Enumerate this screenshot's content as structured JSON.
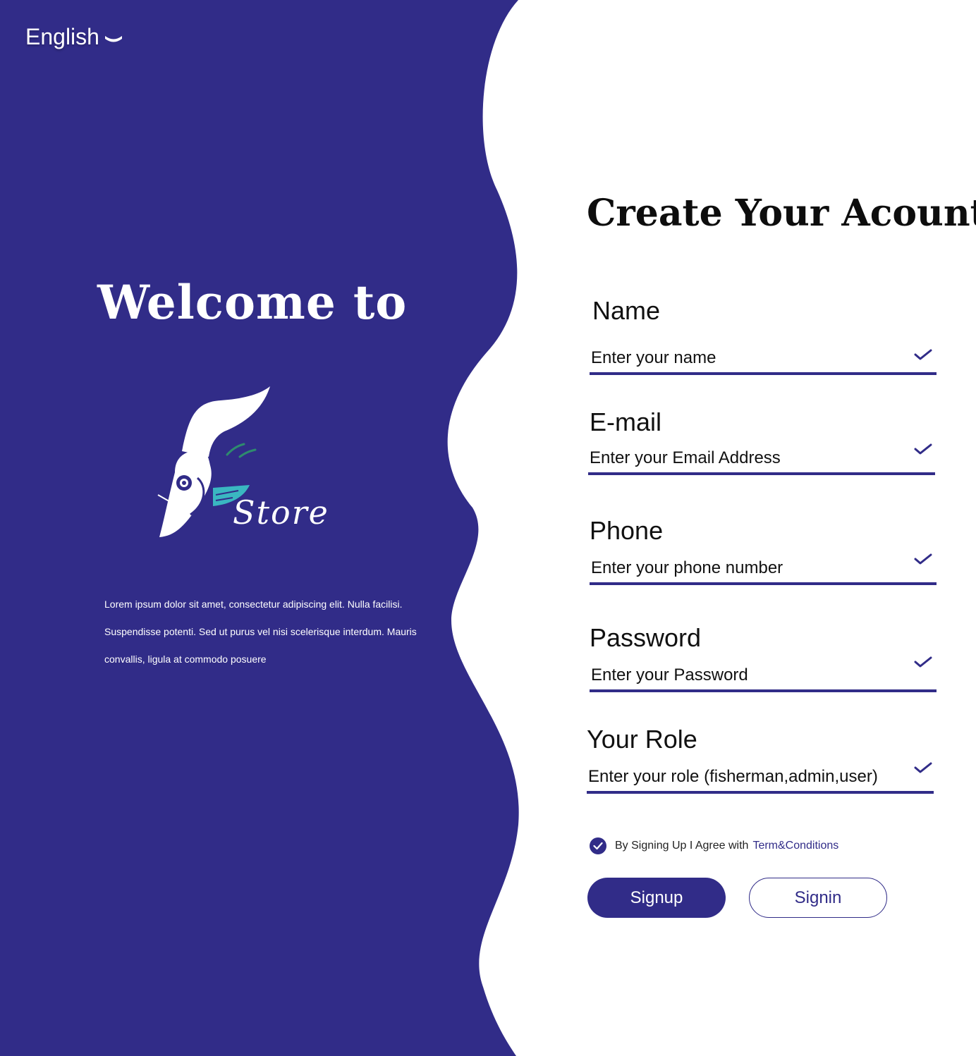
{
  "colors": {
    "brand": "#312c88",
    "white": "#ffffff",
    "accent_teal": "#3ab7c1",
    "accent_green": "#2e8b6e"
  },
  "language_selector": {
    "label": "English",
    "icon": "chevron-down-icon"
  },
  "hero": {
    "welcome": "Welcome to",
    "logo_text": "Store",
    "description": "Lorem ipsum dolor sit amet, consectetur adipiscing elit. Nulla facilisi. Suspendisse potenti. Sed ut purus vel nisi scelerisque interdum. Mauris convallis, ligula at commodo posuere"
  },
  "form": {
    "title": "Create Your Acount",
    "fields": [
      {
        "label": "Name",
        "placeholder": "Enter your name",
        "icon": "check-icon"
      },
      {
        "label": "E-mail",
        "placeholder": "Enter your Email Address",
        "icon": "check-icon"
      },
      {
        "label": "Phone",
        "placeholder": "Enter your phone number",
        "icon": "check-icon"
      },
      {
        "label": "Password",
        "placeholder": "Enter your Password",
        "icon": "check-icon"
      },
      {
        "label": "Your Role",
        "placeholder": "Enter your role (fisherman,admin,user)",
        "icon": "check-icon"
      }
    ],
    "agreement": {
      "text": "By Signing Up I Agree with",
      "link": "Term&Conditions",
      "checked": true
    },
    "signup_label": "Signup",
    "signin_label": "Signin"
  }
}
